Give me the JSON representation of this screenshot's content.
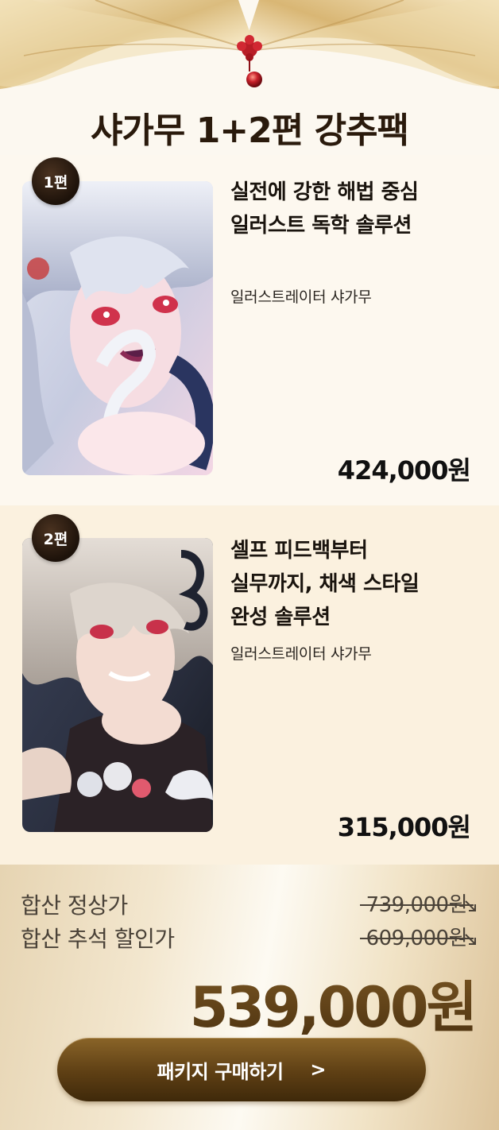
{
  "header": {
    "title": "샤가무 1+2편 강추팩"
  },
  "items": [
    {
      "badge": "1편",
      "headline": [
        "실전에 강한 해법 중심",
        "일러스트 독학 솔루션"
      ],
      "author": "일러스트레이터 샤가무",
      "price": "424,000원"
    },
    {
      "badge": "2편",
      "headline": [
        "셀프 피드백부터",
        "실무까지, 채색 스타일",
        "완성 솔루션"
      ],
      "author": "일러스트레이터 샤가무",
      "price": "315,000원"
    }
  ],
  "summary": {
    "regular_label": "합산 정상가",
    "regular_price": "739,000원",
    "discount_label": "합산 추석 할인가",
    "discount_price": "609,000원",
    "final_price": "539,000원"
  },
  "cta": {
    "label": "패키지 구매하기",
    "arrow": ">"
  },
  "colors": {
    "accent_gold": "#6b4a1a",
    "button_brown": "#5e3f14",
    "page_background": "#fcf8f0",
    "item2_background": "#fbf1df"
  }
}
